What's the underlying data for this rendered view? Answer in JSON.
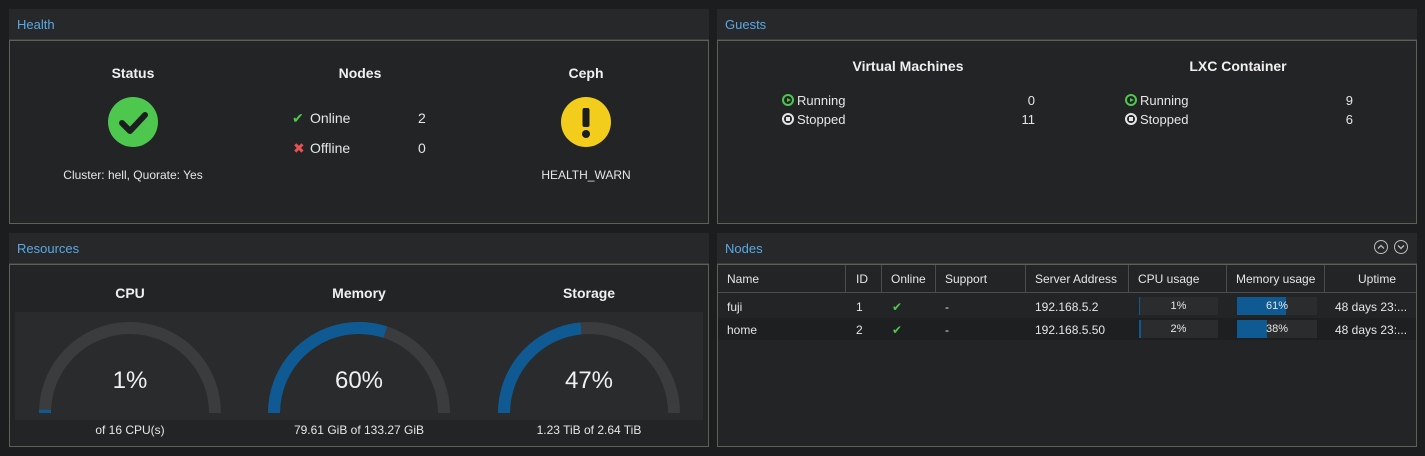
{
  "health": {
    "title": "Health",
    "status": {
      "heading": "Status",
      "text": "Cluster: hell, Quorate: Yes",
      "icon": "check-circle-icon",
      "color": "#4ec74e"
    },
    "nodes": {
      "heading": "Nodes",
      "online_label": "Online",
      "online_count": "2",
      "offline_label": "Offline",
      "offline_count": "0"
    },
    "ceph": {
      "heading": "Ceph",
      "text": "HEALTH_WARN",
      "icon": "exclamation-circle-icon",
      "color": "#f2cd1c"
    }
  },
  "guests": {
    "title": "Guests",
    "vm": {
      "heading": "Virtual Machines",
      "running_label": "Running",
      "running": "0",
      "stopped_label": "Stopped",
      "stopped": "11"
    },
    "lxc": {
      "heading": "LXC Container",
      "running_label": "Running",
      "running": "9",
      "stopped_label": "Stopped",
      "stopped": "6"
    }
  },
  "resources": {
    "title": "Resources",
    "cpu": {
      "heading": "CPU",
      "value": "1%",
      "fraction": 0.01,
      "sub": "of 16 CPU(s)"
    },
    "memory": {
      "heading": "Memory",
      "value": "60%",
      "fraction": 0.6,
      "sub": "79.61 GiB of 133.27 GiB"
    },
    "storage": {
      "heading": "Storage",
      "value": "47%",
      "fraction": 0.47,
      "sub": "1.23 TiB of 2.64 TiB"
    }
  },
  "nodes_panel": {
    "title": "Nodes",
    "columns": [
      "Name",
      "ID",
      "Online",
      "Support",
      "Server Address",
      "CPU usage",
      "Memory usage",
      "Uptime"
    ],
    "rows": [
      {
        "name": "fuji",
        "id": "1",
        "support": "-",
        "address": "192.168.5.2",
        "cpu": "1%",
        "cpu_frac": 0.01,
        "mem": "61%",
        "mem_frac": 0.61,
        "uptime": "48 days 23:..."
      },
      {
        "name": "home",
        "id": "2",
        "support": "-",
        "address": "192.168.5.50",
        "cpu": "2%",
        "cpu_frac": 0.02,
        "mem": "38%",
        "mem_frac": 0.38,
        "uptime": "48 days 23:..."
      }
    ]
  },
  "colors": {
    "accent": "#5aa9e6",
    "online": "#4ec74e",
    "offline": "#e55353",
    "gauge": "#0f5a93"
  }
}
